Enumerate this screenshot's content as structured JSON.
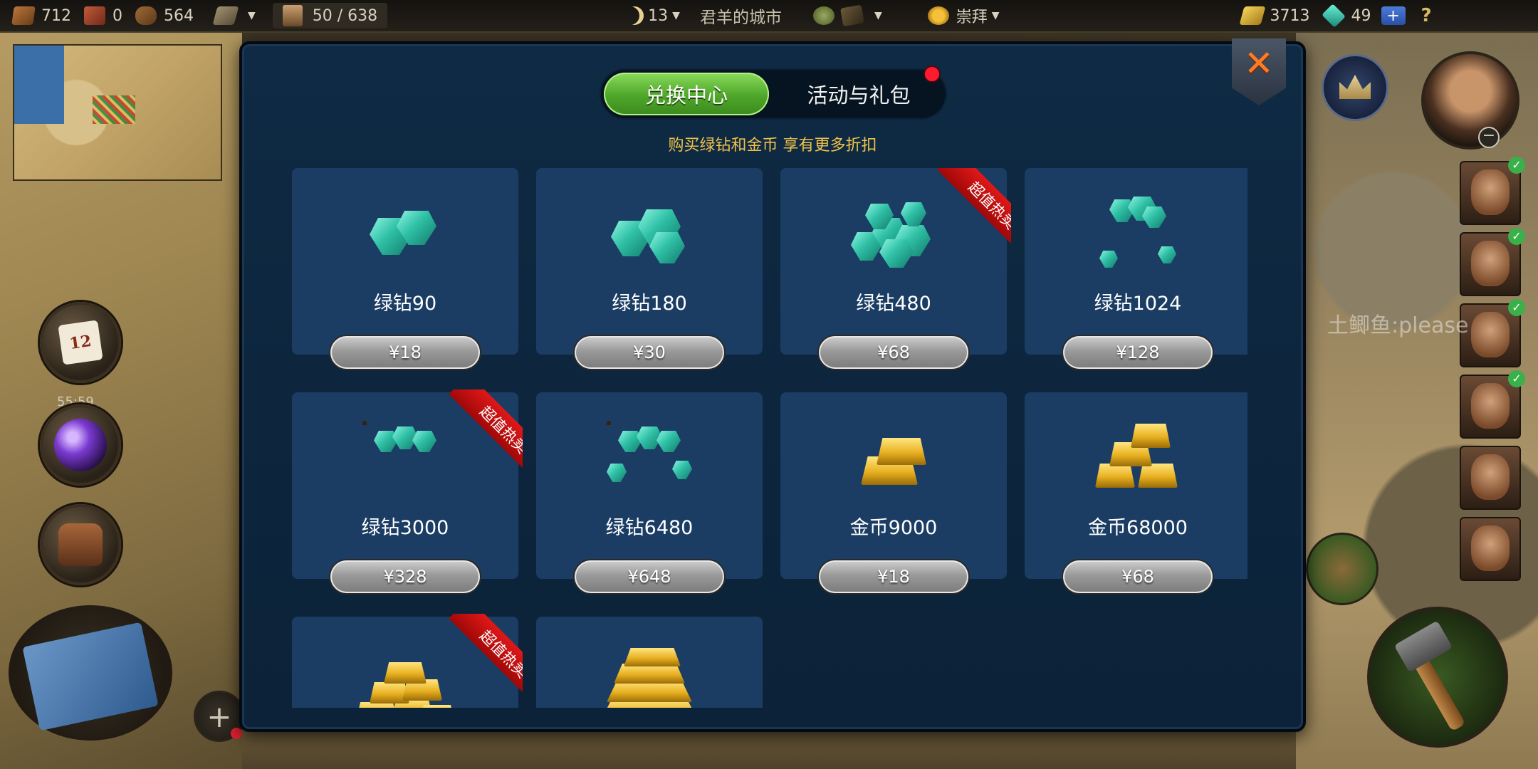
{
  "topbar": {
    "resources": [
      {
        "icon": "wood-crate-icon",
        "value": "712"
      },
      {
        "icon": "brick-icon",
        "value": "0"
      },
      {
        "icon": "log-icon",
        "value": "564"
      }
    ],
    "population": "50 / 638",
    "turn": "13",
    "city_name": "君羊的城市",
    "religion_label": "崇拜",
    "gold": "3713",
    "gems": "49",
    "help_label": "?"
  },
  "side": {
    "calendar_day": "12",
    "potion_timer": "55:59",
    "player_chat": "土鲫鱼:please"
  },
  "shop": {
    "tabs": {
      "exchange": "兑换中心",
      "events": "活动与礼包"
    },
    "promo": "购买绿钻和金币 享有更多折扣",
    "ribbon_label": "超值热卖",
    "products": [
      {
        "name": "绿钻90",
        "price": "¥18",
        "art": "gem-small",
        "hot": false
      },
      {
        "name": "绿钻180",
        "price": "¥30",
        "art": "gem-pair",
        "hot": false
      },
      {
        "name": "绿钻480",
        "price": "¥68",
        "art": "gem-pile",
        "hot": true
      },
      {
        "name": "绿钻1024",
        "price": "¥128",
        "art": "gem-sack",
        "hot": false
      },
      {
        "name": "绿钻3000",
        "price": "¥328",
        "art": "gem-chest",
        "hot": true
      },
      {
        "name": "绿钻6480",
        "price": "¥648",
        "art": "gem-chest-large",
        "hot": false
      },
      {
        "name": "金币9000",
        "price": "¥18",
        "art": "gold-small",
        "hot": false
      },
      {
        "name": "金币68000",
        "price": "¥68",
        "art": "gold-stack",
        "hot": false
      },
      {
        "name": "",
        "price": "",
        "art": "gold-pile",
        "hot": true
      },
      {
        "name": "",
        "price": "",
        "art": "gold-heap",
        "hot": false
      }
    ]
  },
  "colors": {
    "panel_bg": "#0f2a44",
    "card_bg": "#1b3d63",
    "active_tab": "#4ea62a",
    "promo_text": "#f0c24a",
    "ribbon": "#d01010",
    "badge": "#ff1a2e"
  }
}
